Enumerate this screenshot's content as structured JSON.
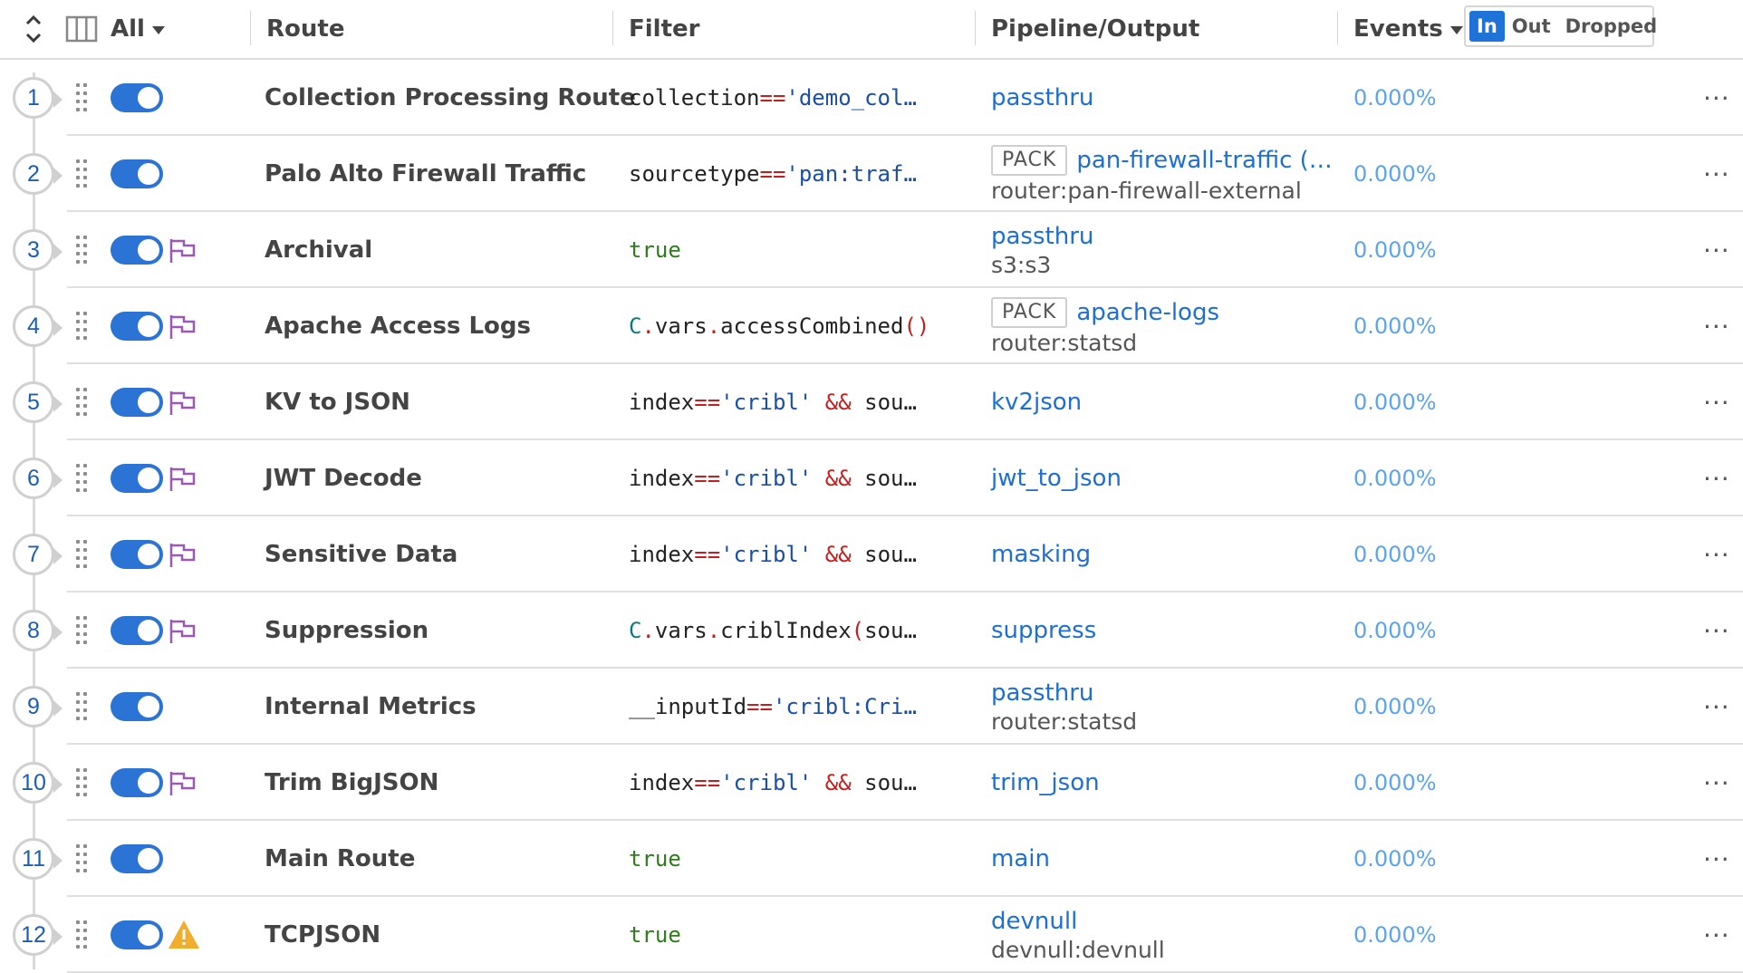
{
  "header": {
    "filter_label": "All",
    "columns": {
      "route": "Route",
      "filter": "Filter",
      "pipeline_output": "Pipeline/Output",
      "events": "Events"
    },
    "events_modes": [
      "In",
      "Out",
      "Dropped"
    ],
    "events_active_mode": "In"
  },
  "colors": {
    "accent": "#1f73d8",
    "link": "#1d6fd6",
    "events_value": "#5ba4ee",
    "flag": "#9b59b6",
    "warning": "#f0ad2e",
    "filter_operator": "#c91d1d",
    "filter_string": "#1a4fa8",
    "filter_keyword": "#2e7d1b"
  },
  "routes": [
    {
      "num": "1",
      "name": "Collection Processing Route",
      "enabled": true,
      "icon": "none",
      "filter": [
        [
          "t",
          "collection"
        ],
        [
          "op",
          "=="
        ],
        [
          "s",
          "'demo_col…"
        ]
      ],
      "pack": "",
      "pipeline": "passthru",
      "output": "",
      "events": "0.000%"
    },
    {
      "num": "2",
      "name": "Palo Alto Firewall Traffic",
      "enabled": true,
      "icon": "none",
      "filter": [
        [
          "t",
          "sourcetype"
        ],
        [
          "op",
          "=="
        ],
        [
          "s",
          "'pan:traf…"
        ]
      ],
      "pack": "PACK",
      "pipeline": "pan-firewall-traffic (…",
      "output": "router:pan-firewall-external",
      "events": "0.000%"
    },
    {
      "num": "3",
      "name": "Archival",
      "enabled": true,
      "icon": "flag",
      "filter": [
        [
          "k",
          "true"
        ]
      ],
      "pack": "",
      "pipeline": "passthru",
      "output": "s3:s3",
      "events": "0.000%"
    },
    {
      "num": "4",
      "name": "Apache Access Logs",
      "enabled": true,
      "icon": "flag",
      "filter": [
        [
          "c",
          "C"
        ],
        [
          "op",
          "."
        ],
        [
          "t",
          "vars"
        ],
        [
          "op",
          "."
        ],
        [
          "t",
          "accessCombined"
        ],
        [
          "op",
          "()"
        ]
      ],
      "pack": "PACK",
      "pipeline": "apache-logs",
      "output": "router:statsd",
      "events": "0.000%"
    },
    {
      "num": "5",
      "name": "KV to JSON",
      "enabled": true,
      "icon": "flag",
      "filter": [
        [
          "t",
          "index"
        ],
        [
          "op",
          "=="
        ],
        [
          "s",
          "'cribl'"
        ],
        [
          "t",
          " "
        ],
        [
          "op",
          "&&"
        ],
        [
          "t",
          " sou…"
        ]
      ],
      "pack": "",
      "pipeline": "kv2json",
      "output": "",
      "events": "0.000%"
    },
    {
      "num": "6",
      "name": "JWT Decode",
      "enabled": true,
      "icon": "flag",
      "filter": [
        [
          "t",
          "index"
        ],
        [
          "op",
          "=="
        ],
        [
          "s",
          "'cribl'"
        ],
        [
          "t",
          " "
        ],
        [
          "op",
          "&&"
        ],
        [
          "t",
          " sou…"
        ]
      ],
      "pack": "",
      "pipeline": "jwt_to_json",
      "output": "",
      "events": "0.000%"
    },
    {
      "num": "7",
      "name": "Sensitive Data",
      "enabled": true,
      "icon": "flag",
      "filter": [
        [
          "t",
          "index"
        ],
        [
          "op",
          "=="
        ],
        [
          "s",
          "'cribl'"
        ],
        [
          "t",
          " "
        ],
        [
          "op",
          "&&"
        ],
        [
          "t",
          " sou…"
        ]
      ],
      "pack": "",
      "pipeline": "masking",
      "output": "",
      "events": "0.000%"
    },
    {
      "num": "8",
      "name": "Suppression",
      "enabled": true,
      "icon": "flag",
      "filter": [
        [
          "c",
          "C"
        ],
        [
          "op",
          "."
        ],
        [
          "t",
          "vars"
        ],
        [
          "op",
          "."
        ],
        [
          "t",
          "criblIndex"
        ],
        [
          "op",
          "("
        ],
        [
          "t",
          "sou…"
        ]
      ],
      "pack": "",
      "pipeline": "suppress",
      "output": "",
      "events": "0.000%"
    },
    {
      "num": "9",
      "name": "Internal Metrics",
      "enabled": true,
      "icon": "none",
      "filter": [
        [
          "t",
          "__inputId"
        ],
        [
          "op",
          "=="
        ],
        [
          "s",
          "'cribl:Cri…"
        ]
      ],
      "pack": "",
      "pipeline": "passthru",
      "output": "router:statsd",
      "events": "0.000%"
    },
    {
      "num": "10",
      "name": "Trim BigJSON",
      "enabled": true,
      "icon": "flag",
      "filter": [
        [
          "t",
          "index"
        ],
        [
          "op",
          "=="
        ],
        [
          "s",
          "'cribl'"
        ],
        [
          "t",
          " "
        ],
        [
          "op",
          "&&"
        ],
        [
          "t",
          " sou…"
        ]
      ],
      "pack": "",
      "pipeline": "trim_json",
      "output": "",
      "events": "0.000%"
    },
    {
      "num": "11",
      "name": "Main Route",
      "enabled": true,
      "icon": "none",
      "filter": [
        [
          "k",
          "true"
        ]
      ],
      "pack": "",
      "pipeline": "main",
      "output": "",
      "events": "0.000%"
    },
    {
      "num": "12",
      "name": "TCPJSON",
      "enabled": true,
      "icon": "warning",
      "filter": [
        [
          "k",
          "true"
        ]
      ],
      "pack": "",
      "pipeline": "devnull",
      "output": "devnull:devnull",
      "events": "0.000%"
    }
  ]
}
